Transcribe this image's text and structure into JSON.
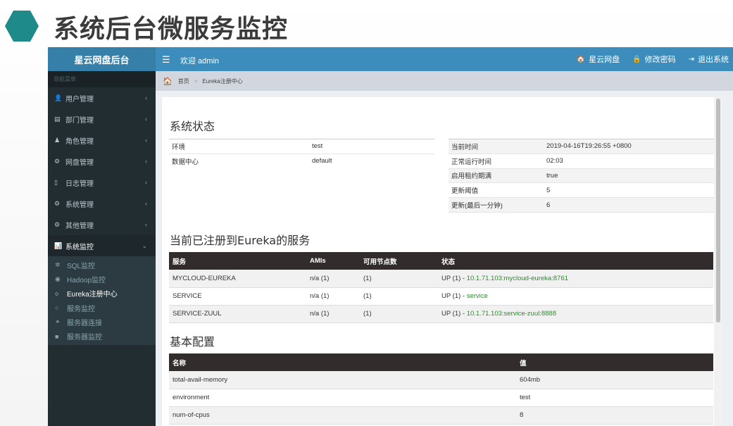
{
  "slide": {
    "title": "系统后台微服务监控"
  },
  "header": {
    "brand": "星云网盘后台",
    "welcome": "欢迎 admin",
    "nav": [
      {
        "icon": "home-icon",
        "glyph": "🏠",
        "label": "星云网盘"
      },
      {
        "icon": "lock-icon",
        "glyph": "🔒",
        "label": "修改密码"
      },
      {
        "icon": "sign-out-icon",
        "glyph": "⇥",
        "label": "退出系统"
      }
    ]
  },
  "sidebar": {
    "header": "导航菜单",
    "items": [
      {
        "icon": "user-icon",
        "glyph": "👤",
        "label": "用户管理"
      },
      {
        "icon": "id-card-icon",
        "glyph": "▤",
        "label": "部门管理"
      },
      {
        "icon": "user-role-icon",
        "glyph": "♟",
        "label": "角色管理"
      },
      {
        "icon": "gear-icon",
        "glyph": "⚙",
        "label": "网盘管理"
      },
      {
        "icon": "file-icon",
        "glyph": "▯",
        "label": "日志管理"
      },
      {
        "icon": "gear-icon",
        "glyph": "⚙",
        "label": "系统管理"
      },
      {
        "icon": "gear-icon",
        "glyph": "⚙",
        "label": "其他管理"
      },
      {
        "icon": "bar-chart-icon",
        "glyph": "📊",
        "label": "系统监控"
      }
    ],
    "subitems": [
      {
        "icon": "bug-icon",
        "glyph": "✲",
        "label": "SQL监控"
      },
      {
        "icon": "eye-icon",
        "glyph": "◉",
        "label": "Hadoop监控"
      },
      {
        "icon": "circle-icon",
        "glyph": "○",
        "label": "Eureka注册中心"
      },
      {
        "icon": "circle-icon",
        "glyph": "○",
        "label": "服务监控"
      },
      {
        "icon": "link-icon",
        "glyph": "⚭",
        "label": "服务器连接"
      },
      {
        "icon": "video-icon",
        "glyph": "■",
        "label": "服务器监控"
      }
    ]
  },
  "breadcrumb": {
    "home": "首页",
    "sep": ">",
    "current": "Eureka注册中心"
  },
  "status": {
    "title": "系统状态",
    "left": [
      {
        "k": "环境",
        "v": "test"
      },
      {
        "k": "数据中心",
        "v": "default"
      }
    ],
    "right": [
      {
        "k": "当前时间",
        "v": "2019-04-16T19:26:55 +0800"
      },
      {
        "k": "正常运行时间",
        "v": "02:03"
      },
      {
        "k": "启用租约期满",
        "v": "true"
      },
      {
        "k": "更新阈值",
        "v": "5"
      },
      {
        "k": "更新(最后一分钟)",
        "v": "6"
      }
    ]
  },
  "services": {
    "title": "当前已注册到Eureka的服务",
    "headers": [
      "服务",
      "AMIs",
      "可用节点数",
      "状态"
    ],
    "rows": [
      {
        "name": "MYCLOUD-EUREKA",
        "amis": "n/a (1)",
        "zones": "(1)",
        "status": "UP (1) - ",
        "link": "10.1.71.103:mycloud-eureka:8761"
      },
      {
        "name": "SERVICE",
        "amis": "n/a (1)",
        "zones": "(1)",
        "status": "UP (1) - ",
        "link": "service"
      },
      {
        "name": "SERVICE-ZUUL",
        "amis": "n/a (1)",
        "zones": "(1)",
        "status": "UP (1) - ",
        "link": "10.1.71.103:service-zuul:8888"
      }
    ]
  },
  "config": {
    "title": "基本配置",
    "headers": [
      "名称",
      "值"
    ],
    "rows": [
      {
        "k": "total-avail-memory",
        "v": "604mb"
      },
      {
        "k": "environment",
        "v": "test"
      },
      {
        "k": "num-of-cpus",
        "v": "8"
      }
    ]
  }
}
